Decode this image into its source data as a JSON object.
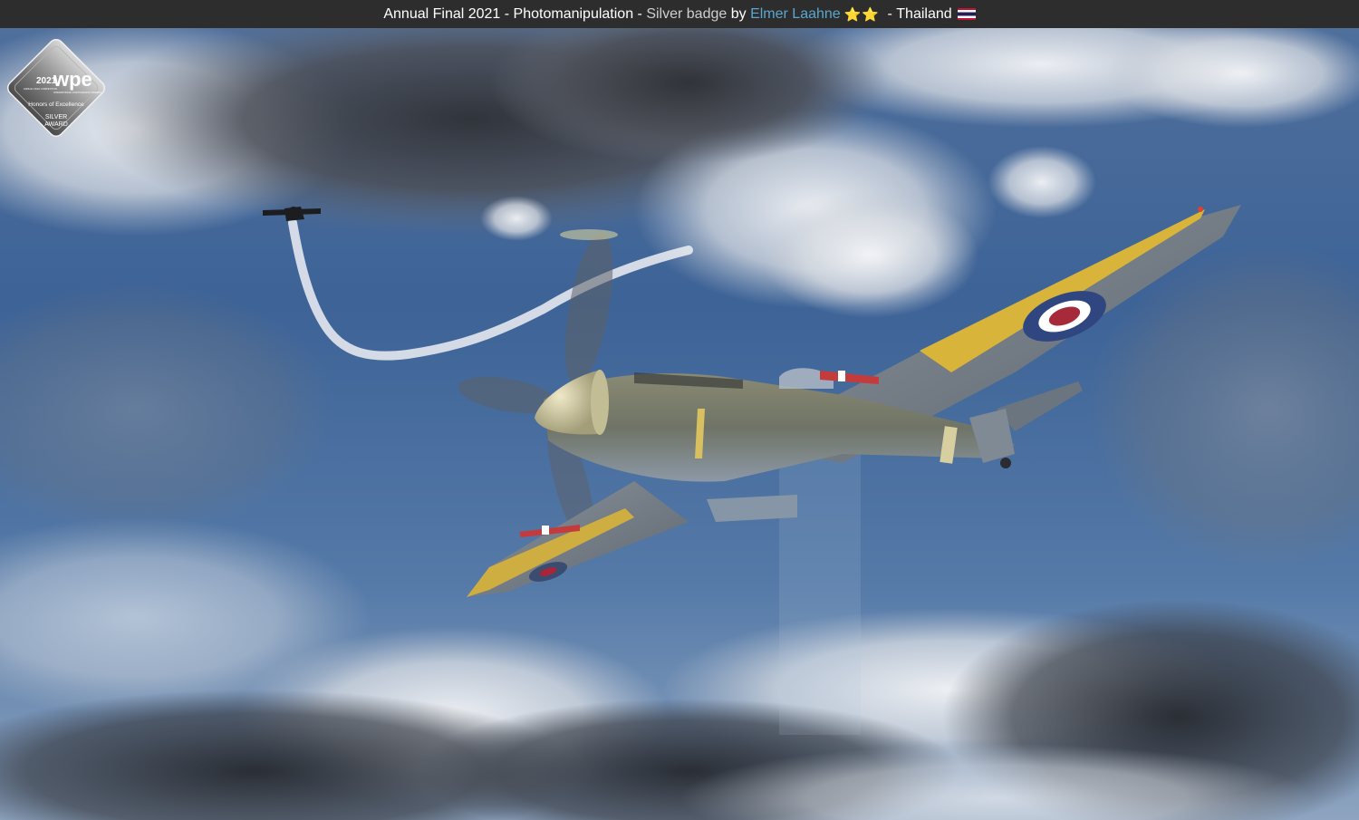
{
  "header": {
    "contest": "Annual Final 2021",
    "sep1": " - ",
    "category": "Photomanipulation",
    "sep2": " - ",
    "award": "Silver badge",
    "by": " by ",
    "author": "Elmer Laahne",
    "stars": "⭐⭐",
    "sep3": " - ",
    "country": "Thailand"
  },
  "badge": {
    "year": "2021",
    "brand": "wpe",
    "subtitle": "Honors of Excellence",
    "award_line1": "SILVER",
    "award_line2": "AWARD",
    "small_left": "ANNUAL FINAL COMPETITION",
    "small_brand": "INTERNATIONAL PHOTOGRAPHY AWARDS"
  },
  "colors": {
    "topbar_bg": "#2d2d2d",
    "author_link": "#5aa7cf",
    "star": "#f2c94c"
  },
  "icons": {
    "rating": "star-icon",
    "flag": "thailand-flag-icon"
  }
}
